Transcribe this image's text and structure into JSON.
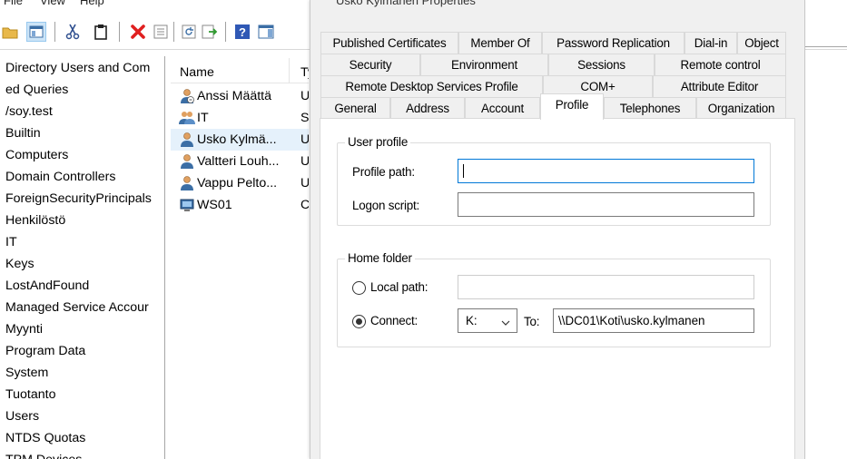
{
  "menubar": {
    "file": "File",
    "view": "View",
    "help": "Help"
  },
  "toolbar": {
    "icons": [
      "folder-up-icon",
      "show-hide-console-tree-icon",
      "cut-icon",
      "copy-icon",
      "delete-icon",
      "properties-icon",
      "refresh-icon",
      "export-list-icon",
      "help-icon",
      "show-action-pane-icon"
    ]
  },
  "tree": {
    "items": [
      "Directory Users and Com",
      "ed Queries",
      "/soy.test",
      "Builtin",
      "Computers",
      "Domain Controllers",
      "ForeignSecurityPrincipals",
      "Henkilöstö",
      "IT",
      "Keys",
      "LostAndFound",
      "Managed Service Accour",
      "Myynti",
      "Program Data",
      "System",
      "Tuotanto",
      "Users",
      "NTDS Quotas",
      "TPM Devices"
    ],
    "selected": "IT"
  },
  "list": {
    "col_name": "Name",
    "col_type": "Ty",
    "rows": [
      {
        "name": "Anssi Määttä",
        "type": "U",
        "icon": "user-icon"
      },
      {
        "name": "IT",
        "type": "S",
        "icon": "group-icon"
      },
      {
        "name": "Usko Kylmä...",
        "type": "U",
        "icon": "user-icon"
      },
      {
        "name": "Valtteri Louh...",
        "type": "U",
        "icon": "user-icon"
      },
      {
        "name": "Vappu Pelto...",
        "type": "U",
        "icon": "user-icon"
      },
      {
        "name": "WS01",
        "type": "C",
        "icon": "computer-icon"
      }
    ]
  },
  "dialog": {
    "title": "Usko Kylmänen Properties",
    "tabs_row1": [
      "Published Certificates",
      "Member Of",
      "Password Replication",
      "Dial-in",
      "Object"
    ],
    "tabs_row2": [
      "Security",
      "Environment",
      "Sessions",
      "Remote control"
    ],
    "tabs_row3": [
      "Remote Desktop Services Profile",
      "COM+",
      "Attribute Editor"
    ],
    "tabs_row4": [
      "General",
      "Address",
      "Account",
      "Profile",
      "Telephones",
      "Organization"
    ],
    "active_tab": "Profile",
    "user_profile": {
      "legend": "User profile",
      "profile_path_label": "Profile path:",
      "profile_path_value": "",
      "logon_script_label": "Logon script:",
      "logon_script_value": ""
    },
    "home_folder": {
      "legend": "Home folder",
      "local_path_label": "Local path:",
      "local_path_value": "",
      "local_path_selected": false,
      "connect_label": "Connect:",
      "connect_selected": true,
      "drive_value": "K:",
      "to_label": "To:",
      "to_value": "\\\\DC01\\Koti\\usko.kylmanen"
    }
  }
}
